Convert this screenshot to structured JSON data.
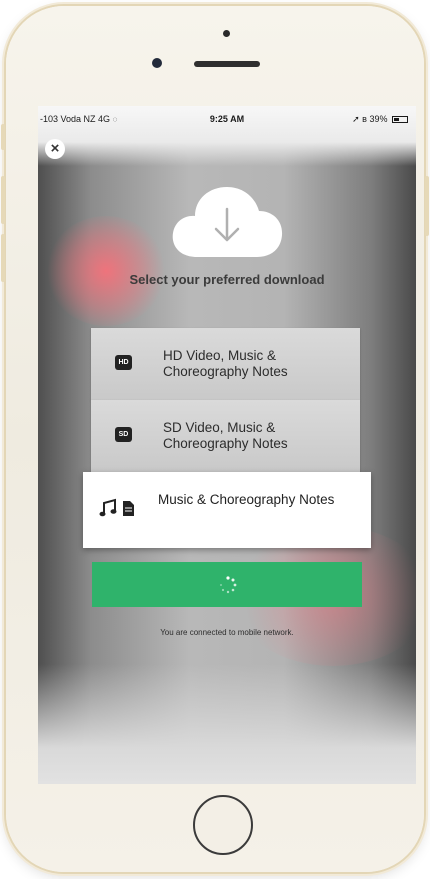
{
  "status_bar": {
    "carrier": "-103 Voda NZ  4G",
    "time": "9:25 AM",
    "battery": "39%",
    "battery_level": 0.39
  },
  "download_prompt": "Select your preferred download",
  "options": [
    {
      "badge": "HD",
      "label": "HD Video, Music & Choreography Notes",
      "selected": false
    },
    {
      "badge": "SD",
      "label": "SD Video, Music & Choreography Notes",
      "selected": false
    },
    {
      "icons": [
        "music-note-icon",
        "document-icon"
      ],
      "label": "Music & Choreography Notes",
      "selected": true
    }
  ],
  "download_button": {
    "state": "loading",
    "color": "#2fb36b"
  },
  "network_note": "You are connected to mobile network.",
  "icons": {
    "close": "close-icon",
    "cloud": "cloud-download-icon",
    "spinner": "loading-spinner-icon"
  },
  "colors": {
    "accent_green": "#2fb36b",
    "selected_option": "#ffffff",
    "option_background": "#d2d2d2"
  }
}
